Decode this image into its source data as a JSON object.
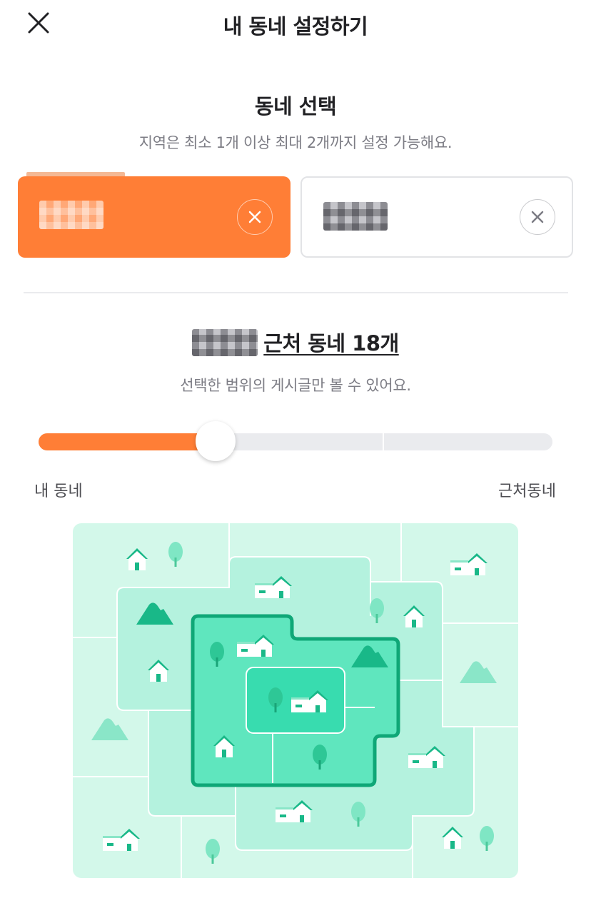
{
  "header": {
    "title": "내 동네 설정하기",
    "close_icon": "close-icon"
  },
  "selection": {
    "title": "동네 선택",
    "description": "지역은 최소 1개 이상 최대 2개까지 설정 가능해요.",
    "neighborhoods": [
      {
        "name": "",
        "selected": true,
        "clear_icon": "circle-x-icon"
      },
      {
        "name": "",
        "selected": false,
        "clear_icon": "circle-x-icon"
      }
    ]
  },
  "range": {
    "title_link": "근처 동네 18개",
    "description": "선택한 범위의 게시글만 볼 수 있어요.",
    "slider": {
      "level": 0.345,
      "min_label": "내 동네",
      "max_label": "근처동네",
      "tick_positions": [
        0.345,
        0.671
      ]
    }
  },
  "colors": {
    "accent": "#ff7e36",
    "map_light": "#d3f8ea",
    "map_mid": "#b4f2de",
    "map_selected": "#5fe6be",
    "map_core": "#38dcaf",
    "map_border": "#0fa777"
  }
}
